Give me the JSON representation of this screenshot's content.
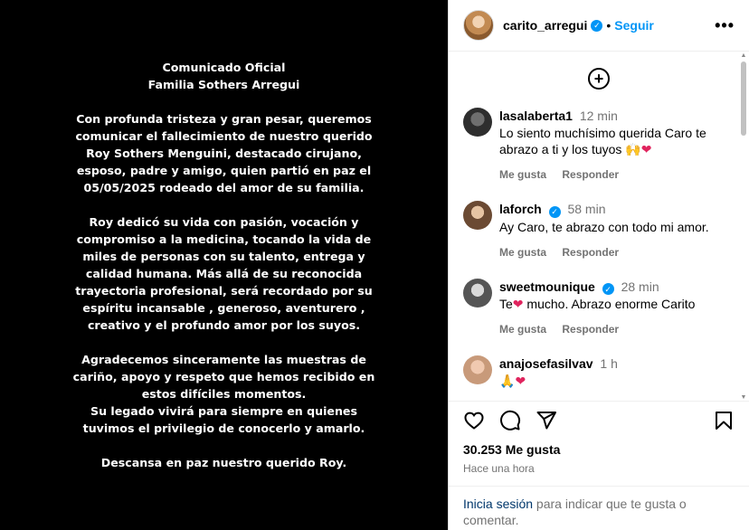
{
  "post": {
    "statement_title": "Comunicado Oficial\nFamilia Sothers Arregui",
    "paragraph_1": "Con profunda tristeza y gran pesar, queremos\ncomunicar el fallecimiento de nuestro querido\nRoy Sothers Menguini, destacado cirujano,\nesposo, padre y amigo, quien partió en paz el\n05/05/2025 rodeado del amor de su familia.",
    "paragraph_2": "Roy dedicó su vida con pasión, vocación y\ncompromiso a la medicina, tocando la vida de\nmiles de personas con su talento, entrega y\ncalidad humana. Más allá de su reconocida\ntrayectoria profesional, será recordado por su\nespíritu incansable , generoso, aventurero ,\ncreativo y el profundo amor por los suyos.",
    "paragraph_3": "Agradecemos sinceramente las muestras de\ncariño, apoyo y respeto que hemos recibido en\nestos difíciles momentos.\nSu legado vivirá para siempre en quienes\ntuvimos el privilegio de conocerlo y amarlo.",
    "paragraph_4": "Descansa en paz nuestro querido Roy."
  },
  "header": {
    "username": "carito_arregui",
    "separator": "•",
    "follow_label": "Seguir",
    "more_label": "•••",
    "verified_mark": "✓"
  },
  "comments": [
    {
      "user": "lasalaberta1",
      "time": "12 min",
      "text_before_emoji": "Lo siento muchísimo querida Caro te abrazo a ti y los tuyos ",
      "emoji": "🙌",
      "heart": "❤",
      "like_label": "Me gusta",
      "reply_label": "Responder"
    },
    {
      "user": "laforch",
      "time": "58 min",
      "text": "Ay Caro, te abrazo con todo mi amor.",
      "like_label": "Me gusta",
      "reply_label": "Responder"
    },
    {
      "user": "sweetmounique",
      "time": "28 min",
      "text_before": "Te",
      "heart": "❤",
      "text_after": " mucho. Abrazo enorme Carito",
      "like_label": "Me gusta",
      "reply_label": "Responder"
    },
    {
      "user": "anajosefasilvav",
      "time": "1 h",
      "emoji": "🙏",
      "heart": "❤"
    }
  ],
  "add_comment_symbol": "+",
  "likes_text": "30.253 Me gusta",
  "time_ago": "Hace una hora",
  "login": {
    "link": "Inicia sesión",
    "rest": " para indicar que te gusta o comentar."
  },
  "icons": [
    "heart-icon",
    "comment-icon",
    "share-icon",
    "save-icon",
    "plus-circle-icon",
    "verified-icon",
    "more-icon"
  ],
  "colors": {
    "accent": "#0095f6",
    "muted": "#737373",
    "heart": "#e0245e",
    "image_bg": "#000000"
  }
}
